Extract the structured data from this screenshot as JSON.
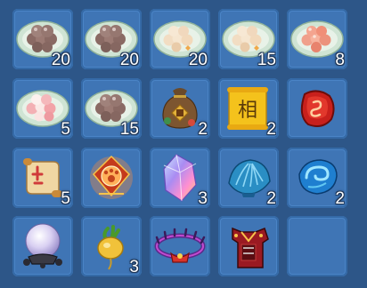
{
  "inventory": {
    "slots": [
      {
        "item_icon": "brown-rice-balls-plate-icon",
        "count": "20"
      },
      {
        "item_icon": "brown-rice-balls-plate-icon",
        "count": "20"
      },
      {
        "item_icon": "cream-rice-balls-plate-icon",
        "count": "20"
      },
      {
        "item_icon": "cream-rice-balls-plate-icon",
        "count": "15"
      },
      {
        "item_icon": "pink-rice-balls-plate-icon",
        "count": "8"
      },
      {
        "item_icon": "pink-white-rice-balls-plate-icon",
        "count": "5"
      },
      {
        "item_icon": "brown-rice-balls-plate-icon",
        "count": "15"
      },
      {
        "item_icon": "treasure-money-bag-icon",
        "count": "2"
      },
      {
        "item_icon": "physiognomy-scroll-icon",
        "count": "2",
        "glyph": "相"
      },
      {
        "item_icon": "red-rune-stone-icon",
        "count": ""
      },
      {
        "item_icon": "red-scroll-icon",
        "count": "5"
      },
      {
        "item_icon": "glowing-paw-seal-icon",
        "count": ""
      },
      {
        "item_icon": "rainbow-crystal-icon",
        "count": "3"
      },
      {
        "item_icon": "blue-seashell-icon",
        "count": "2"
      },
      {
        "item_icon": "blue-swirl-stone-icon",
        "count": "2"
      },
      {
        "item_icon": "crystal-ball-icon",
        "count": ""
      },
      {
        "item_icon": "golden-radish-icon",
        "count": "3"
      },
      {
        "item_icon": "thorn-crown-icon",
        "count": ""
      },
      {
        "item_icon": "red-armor-icon",
        "count": ""
      },
      {
        "item_icon": "empty-slot",
        "count": ""
      }
    ]
  }
}
